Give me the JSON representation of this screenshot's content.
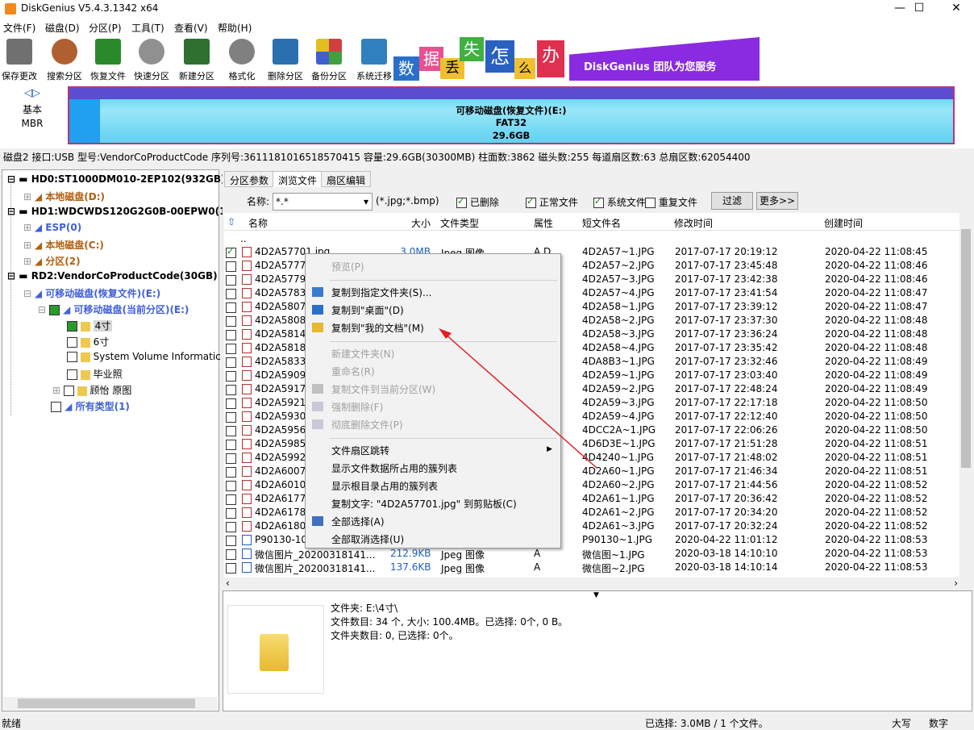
{
  "window": {
    "title": "DiskGenius V5.4.3.1342 x64",
    "min": "—",
    "max": "☐",
    "close": "✕"
  },
  "menu": [
    "文件(F)",
    "磁盘(D)",
    "分区(P)",
    "工具(T)",
    "查看(V)",
    "帮助(H)"
  ],
  "toolbar": [
    {
      "label": "保存更改",
      "icon": "save-icon",
      "color": "#707070"
    },
    {
      "label": "搜索分区",
      "icon": "search-icon",
      "color": "#b06030"
    },
    {
      "label": "恢复文件",
      "icon": "recover-icon",
      "color": "#2a8a2a"
    },
    {
      "label": "快速分区",
      "icon": "quick-partition-icon",
      "color": "#909090"
    },
    {
      "label": "新建分区",
      "icon": "new-partition-icon",
      "color": "#2f6f2f"
    },
    {
      "label": "格式化",
      "icon": "format-icon",
      "color": "#808080"
    },
    {
      "label": "删除分区",
      "icon": "delete-icon",
      "color": "#2a70b0"
    },
    {
      "label": "备份分区",
      "icon": "backup-icon",
      "color": "#d04040"
    },
    {
      "label": "系统迁移",
      "icon": "migrate-icon",
      "color": "#3080c0"
    }
  ],
  "banner": {
    "chars": [
      "数",
      "据",
      "丢",
      "失",
      "怎",
      "么",
      "办"
    ],
    "text": "DiskGenius 团队为您服务"
  },
  "disk_map": {
    "nav_left": "◁",
    "nav_right": "▷",
    "type1": "基本",
    "type2": "MBR",
    "partition_name": "可移动磁盘(恢复文件)(E:)",
    "fs": "FAT32",
    "size": "29.6GB"
  },
  "disk_info": "磁盘2 接口:USB  型号:VendorCoProductCode  序列号:3611181016518570415  容量:29.6GB(30300MB)  柱面数:3862  磁头数:255  每道扇区数:63  总扇区数:62054400",
  "tree": [
    {
      "text": "HD0:ST1000DM010-2EP102(932GB)",
      "cls": "bold",
      "depth": 0
    },
    {
      "text": "本地磁盘(D:)",
      "cls": "orange",
      "depth": 1
    },
    {
      "text": "HD1:WDCWDS120G2G0B-00EPW0(11",
      "cls": "bold",
      "depth": 0
    },
    {
      "text": "ESP(0)",
      "cls": "blue",
      "depth": 1
    },
    {
      "text": "本地磁盘(C:)",
      "cls": "orange",
      "depth": 1
    },
    {
      "text": "分区(2)",
      "cls": "orange",
      "depth": 1
    },
    {
      "text": "RD2:VendorCoProductCode(30GB)",
      "cls": "bold",
      "depth": 0
    },
    {
      "text": "可移动磁盘(恢复文件)(E:)",
      "cls": "blue",
      "depth": 1
    },
    {
      "text": "可移动磁盘(当前分区)(E:)",
      "cls": "blue",
      "depth": 2
    },
    {
      "text": "4寸",
      "cls": "",
      "depth": 3
    },
    {
      "text": "6寸",
      "cls": "",
      "depth": 3
    },
    {
      "text": "System Volume Informatic",
      "cls": "",
      "depth": 3
    },
    {
      "text": "毕业照",
      "cls": "",
      "depth": 3
    },
    {
      "text": "顾怡 原图",
      "cls": "",
      "depth": 3
    },
    {
      "text": "所有类型(1)",
      "cls": "blue",
      "depth": 2
    }
  ],
  "tabs": [
    "分区参数",
    "浏览文件",
    "扇区编辑"
  ],
  "filter": {
    "name_label": "名称:",
    "name_value": "*.*",
    "hint": "(*.jpg;*.bmp)",
    "deleted": "已删除",
    "normal": "正常文件",
    "system": "系统文件",
    "duplicate": "重复文件",
    "filter_btn": "过滤",
    "more_btn": "更多>>"
  },
  "columns": {
    "name": "名称",
    "size": "大小",
    "type": "文件类型",
    "attr": "属性",
    "short": "短文件名",
    "mtime": "修改时间",
    "ctime": "创建时间"
  },
  "parent_row": "..",
  "files": [
    {
      "name": "4D2A57701.jpg",
      "size": "3.0MB",
      "type": "Jpeg 图像",
      "attr": "A D",
      "short": "4D2A57~1.JPG",
      "mtime": "2017-07-17 20:19:12",
      "ctime": "2020-04-22 11:08:45",
      "checked": true
    },
    {
      "name": "4D2A5777",
      "short": "4D2A57~2.JPG",
      "mtime": "2017-07-17 23:45:48",
      "ctime": "2020-04-22 11:08:46"
    },
    {
      "name": "4D2A5779",
      "short": "4D2A57~3.JPG",
      "mtime": "2017-07-17 23:42:38",
      "ctime": "2020-04-22 11:08:46"
    },
    {
      "name": "4D2A5783",
      "short": "4D2A57~4.JPG",
      "mtime": "2017-07-17 23:41:54",
      "ctime": "2020-04-22 11:08:47"
    },
    {
      "name": "4D2A5807",
      "short": "4D2A58~1.JPG",
      "mtime": "2017-07-17 23:39:12",
      "ctime": "2020-04-22 11:08:47"
    },
    {
      "name": "4D2A5808",
      "short": "4D2A58~2.JPG",
      "mtime": "2017-07-17 23:37:30",
      "ctime": "2020-04-22 11:08:48"
    },
    {
      "name": "4D2A5814",
      "short": "4D2A58~3.JPG",
      "mtime": "2017-07-17 23:36:24",
      "ctime": "2020-04-22 11:08:48"
    },
    {
      "name": "4D2A5818",
      "short": "4D2A58~4.JPG",
      "mtime": "2017-07-17 23:35:42",
      "ctime": "2020-04-22 11:08:48"
    },
    {
      "name": "4D2A5833",
      "short": "4DA8B3~1.JPG",
      "mtime": "2017-07-17 23:32:46",
      "ctime": "2020-04-22 11:08:49"
    },
    {
      "name": "4D2A5909",
      "short": "4D2A59~1.JPG",
      "mtime": "2017-07-17 23:03:40",
      "ctime": "2020-04-22 11:08:49"
    },
    {
      "name": "4D2A5917",
      "short": "4D2A59~2.JPG",
      "mtime": "2017-07-17 22:48:24",
      "ctime": "2020-04-22 11:08:49"
    },
    {
      "name": "4D2A5921",
      "short": "4D2A59~3.JPG",
      "mtime": "2017-07-17 22:17:18",
      "ctime": "2020-04-22 11:08:50"
    },
    {
      "name": "4D2A5930",
      "short": "4D2A59~4.JPG",
      "mtime": "2017-07-17 22:12:40",
      "ctime": "2020-04-22 11:08:50"
    },
    {
      "name": "4D2A5956",
      "short": "4DCC2A~1.JPG",
      "mtime": "2017-07-17 22:06:26",
      "ctime": "2020-04-22 11:08:50"
    },
    {
      "name": "4D2A5985",
      "short": "4D6D3E~1.JPG",
      "mtime": "2017-07-17 21:51:28",
      "ctime": "2020-04-22 11:08:51"
    },
    {
      "name": "4D2A5992",
      "short": "4D4240~1.JPG",
      "mtime": "2017-07-17 21:48:02",
      "ctime": "2020-04-22 11:08:51"
    },
    {
      "name": "4D2A6007",
      "short": "4D2A60~1.JPG",
      "mtime": "2017-07-17 21:46:34",
      "ctime": "2020-04-22 11:08:51"
    },
    {
      "name": "4D2A6010",
      "short": "4D2A60~2.JPG",
      "mtime": "2017-07-17 21:44:56",
      "ctime": "2020-04-22 11:08:52"
    },
    {
      "name": "4D2A6177",
      "short": "4D2A61~1.JPG",
      "mtime": "2017-07-17 20:36:42",
      "ctime": "2020-04-22 11:08:52"
    },
    {
      "name": "4D2A6178",
      "short": "4D2A61~2.JPG",
      "mtime": "2017-07-17 20:34:20",
      "ctime": "2020-04-22 11:08:52"
    },
    {
      "name": "4D2A6180",
      "short": "4D2A61~3.JPG",
      "mtime": "2017-07-17 20:32:24",
      "ctime": "2020-04-22 11:08:52"
    },
    {
      "name": "P90130-10",
      "short": "P90130~1.JPG",
      "mtime": "2020-04-22 11:01:12",
      "ctime": "2020-04-22 11:08:53"
    },
    {
      "name": "微信图片_20200318141...",
      "size": "212.9KB",
      "type": "Jpeg 图像",
      "attr": "A",
      "short": "微信图~1.JPG",
      "mtime": "2020-03-18 14:10:10",
      "ctime": "2020-04-22 11:08:53"
    },
    {
      "name": "微信图片_20200318141...",
      "size": "137.6KB",
      "type": "Jpeg 图像",
      "attr": "A",
      "short": "微信图~2.JPG",
      "mtime": "2020-03-18 14:10:14",
      "ctime": "2020-04-22 11:08:53"
    }
  ],
  "context_menu": [
    {
      "label": "预览(P)",
      "disabled": true
    },
    {
      "sep": true
    },
    {
      "label": "复制到指定文件夹(S)...",
      "icon": "copy-folder-icon"
    },
    {
      "label": "复制到\"桌面\"(D)",
      "icon": "desktop-icon"
    },
    {
      "label": "复制到\"我的文档\"(M)",
      "icon": "documents-icon"
    },
    {
      "sep": true
    },
    {
      "label": "新建文件夹(N)",
      "disabled": true
    },
    {
      "label": "重命名(R)",
      "disabled": true
    },
    {
      "label": "复制文件到当前分区(W)",
      "disabled": true,
      "icon": "copy-partition-icon"
    },
    {
      "label": "强制删除(F)",
      "disabled": true,
      "icon": "force-delete-icon"
    },
    {
      "label": "彻底删除文件(P)",
      "disabled": true,
      "icon": "wipe-icon"
    },
    {
      "sep": true
    },
    {
      "label": "文件扇区跳转",
      "submenu": true
    },
    {
      "label": "显示文件数据所占用的簇列表"
    },
    {
      "label": "显示根目录占用的簇列表"
    },
    {
      "label": "复制文字: \"4D2A57701.jpg\" 到剪贴板(C)"
    },
    {
      "label": "全部选择(A)",
      "icon": "select-all-icon"
    },
    {
      "label": "全部取消选择(U)"
    }
  ],
  "info": {
    "line1": "文件夹: E:\\4寸\\",
    "line2": "文件数目: 34 个, 大小: 100.4MB。已选择: 0个, 0 B。",
    "line3": "文件夹数目: 0, 已选择: 0个。"
  },
  "status": {
    "left": "就绪",
    "selected": "已选择: 3.0MB / 1 个文件。",
    "caps": "大写",
    "num": "数字"
  },
  "colors": {
    "arrow": "#e02020",
    "banner": "#8a2be2",
    "partition_border": "#c0307a"
  }
}
